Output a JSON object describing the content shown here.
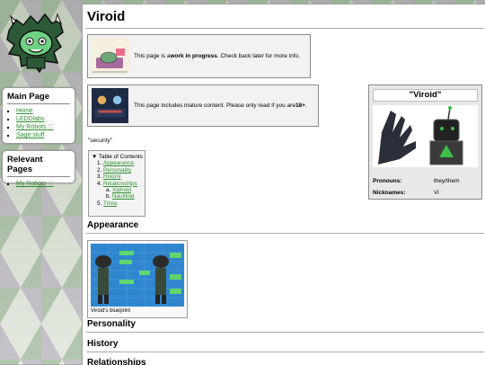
{
  "page": {
    "title": "Viroid"
  },
  "sidebar": {
    "main": {
      "heading": "Main Page",
      "items": [
        {
          "label": "Home"
        },
        {
          "label": "LEDDlabs"
        },
        {
          "label": "My Robots ♡"
        },
        {
          "label": "Sage stuff"
        }
      ]
    },
    "relevant": {
      "heading": "Relevant Pages",
      "items": [
        {
          "label": "My Robots ♡"
        }
      ]
    }
  },
  "notices": {
    "wip": {
      "pre": "This page is a ",
      "bold": "work in progress",
      "post": ". Check back later for more info."
    },
    "mature": {
      "pre": "This page includes mature content. Please only read if you are ",
      "bold": "18+",
      "post": "."
    }
  },
  "security_label": "\"security\"",
  "toc": {
    "title": "Table of Contents",
    "items": [
      {
        "num": "1.",
        "label": "Appearance"
      },
      {
        "num": "2.",
        "label": "Personality"
      },
      {
        "num": "3.",
        "label": "History"
      },
      {
        "num": "4.",
        "label": "Relationships"
      },
      {
        "num": "5.",
        "label": "Trivia"
      }
    ],
    "sub": [
      {
        "label": "Xiphoid"
      },
      {
        "label": "Nautiloid"
      }
    ]
  },
  "sections": {
    "appearance": "Appearance",
    "personality": "Personality",
    "history": "History",
    "relationships": "Relationships"
  },
  "thumbnail": {
    "caption": "Viroid's blueprint"
  },
  "infobox": {
    "title": "\"Viroid\"",
    "rows": [
      {
        "key": "Pronouns:",
        "value": "they/them"
      },
      {
        "key": "Nicknames:",
        "value": "Vi"
      }
    ]
  },
  "colors": {
    "link": "#2f8f2f",
    "accent_green": "#3cc04a",
    "blueprint": "#2f86cf"
  }
}
